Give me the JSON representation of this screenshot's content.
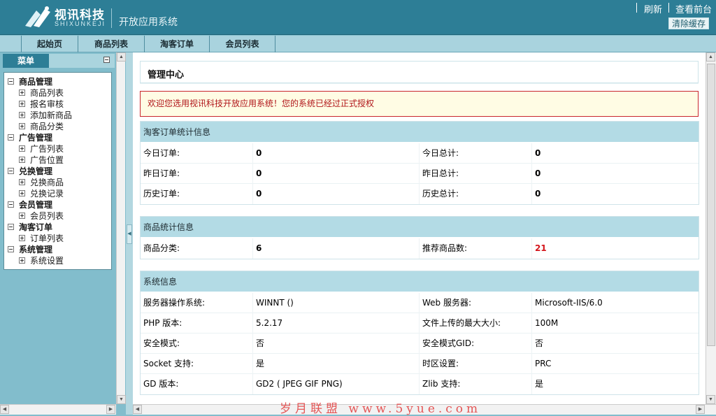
{
  "header": {
    "brand": "视讯科技",
    "brand_sub": "SHIXUNKEJI",
    "system_title": "开放应用系统",
    "links": [
      "刷新",
      "查看前台"
    ],
    "clear_cache": "清除缓存"
  },
  "nav": {
    "tabs": [
      "起始页",
      "商品列表",
      "淘客订单",
      "会员列表"
    ]
  },
  "menu": {
    "title": "菜单",
    "categories": [
      {
        "label": "商品管理",
        "items": [
          "商品列表",
          "报名审核",
          "添加新商品",
          "商品分类"
        ]
      },
      {
        "label": "广告管理",
        "items": [
          "广告列表",
          "广告位置"
        ]
      },
      {
        "label": "兑换管理",
        "items": [
          "兑换商品",
          "兑换记录"
        ]
      },
      {
        "label": "会员管理",
        "items": [
          "会员列表"
        ]
      },
      {
        "label": "淘客订单",
        "items": [
          "订单列表"
        ]
      },
      {
        "label": "系统管理",
        "items": [
          "系统设置"
        ]
      }
    ]
  },
  "main": {
    "page_title": "管理中心",
    "notice": "欢迎您选用视讯科技开放应用系统！您的系统已经过正式授权",
    "order_panel": {
      "title": "淘客订单统计信息",
      "rows": [
        [
          "今日订单:",
          "0",
          "今日总计:",
          "0"
        ],
        [
          "昨日订单:",
          "0",
          "昨日总计:",
          "0"
        ],
        [
          "历史订单:",
          "0",
          "历史总计:",
          "0"
        ]
      ]
    },
    "goods_panel": {
      "title": "商品统计信息",
      "rows": [
        [
          "商品分类:",
          "6",
          "推荐商品数:",
          "21"
        ]
      ]
    },
    "system_panel": {
      "title": "系统信息",
      "rows": [
        [
          "服务器操作系统:",
          "WINNT ()",
          "Web 服务器:",
          "Microsoft-IIS/6.0"
        ],
        [
          "PHP 版本:",
          "5.2.17",
          "文件上传的最大大小:",
          "100M"
        ],
        [
          "安全模式:",
          "否",
          "安全模式GID:",
          "否"
        ],
        [
          "Socket 支持:",
          "是",
          "时区设置:",
          "PRC"
        ],
        [
          "GD 版本:",
          "GD2 ( JPEG GIF PNG)",
          "Zlib 支持:",
          "是"
        ]
      ]
    }
  },
  "watermark": "岁月联盟 www.5yue.com",
  "colors": {
    "header_bg": "#2d7e96",
    "nav_bg": "#a9d3de",
    "panel_head": "#b3dbe5",
    "notice_border": "#c9262d",
    "accent_red": "#d4161c"
  }
}
